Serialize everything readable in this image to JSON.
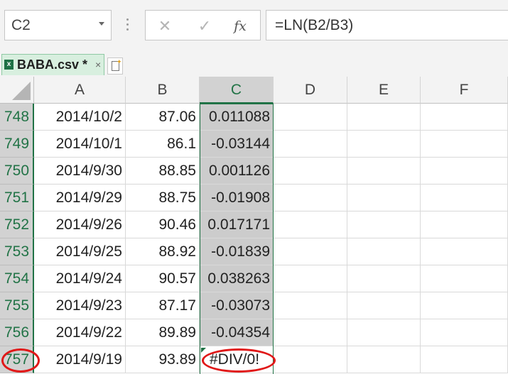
{
  "name_box": {
    "value": "C2"
  },
  "formula_bar": {
    "cancel_glyph": "✕",
    "enter_glyph": "✓",
    "fx_label": "fx",
    "formula": "=LN(B2/B3)"
  },
  "sheet_tab": {
    "label": "BABA.csv *",
    "close_glyph": "×",
    "file_icon": "excel-file-icon"
  },
  "new_tab_icon": "new-sheet-icon",
  "columns": [
    "A",
    "B",
    "C",
    "D",
    "E",
    "F"
  ],
  "selected_column": "C",
  "rows": [
    {
      "num": "748",
      "a": "2014/10/2",
      "b": "87.06",
      "c": "0.011088"
    },
    {
      "num": "749",
      "a": "2014/10/1",
      "b": "86.1",
      "c": "-0.03144"
    },
    {
      "num": "750",
      "a": "2014/9/30",
      "b": "88.85",
      "c": "0.001126"
    },
    {
      "num": "751",
      "a": "2014/9/29",
      "b": "88.75",
      "c": "-0.01908"
    },
    {
      "num": "752",
      "a": "2014/9/26",
      "b": "90.46",
      "c": "0.017171"
    },
    {
      "num": "753",
      "a": "2014/9/25",
      "b": "88.92",
      "c": "-0.01839"
    },
    {
      "num": "754",
      "a": "2014/9/24",
      "b": "90.57",
      "c": "0.038263"
    },
    {
      "num": "755",
      "a": "2014/9/23",
      "b": "87.17",
      "c": "-0.03073"
    },
    {
      "num": "756",
      "a": "2014/9/22",
      "b": "89.89",
      "c": "-0.04354"
    },
    {
      "num": "757",
      "a": "2014/9/19",
      "b": "93.89",
      "c": "#DIV/0!"
    }
  ],
  "colors": {
    "accent_green": "#217346",
    "selection_gray": "#cccccc",
    "annotation_red": "#e01818"
  }
}
